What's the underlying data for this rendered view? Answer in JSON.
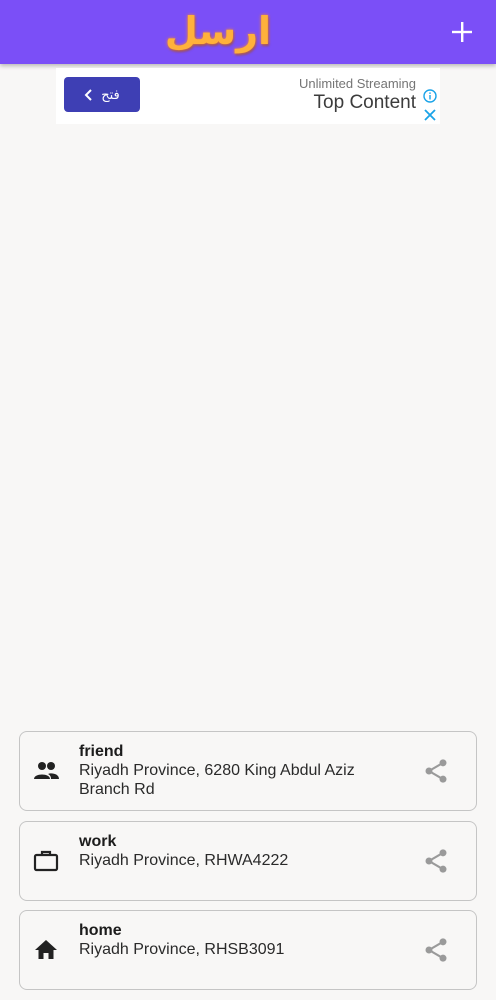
{
  "app_bar": {
    "logo_text": "ارسل",
    "add_icon": "plus-icon",
    "background_color": "#7b4ff7",
    "logo_color": "#ffb13b"
  },
  "ad": {
    "open_button_label": "فتح",
    "open_button_icon": "chevron-left-icon",
    "subtitle": "Unlimited Streaming",
    "title": "Top Content",
    "info_icon": "info-icon",
    "close_icon": "close-icon",
    "button_color": "#3e3fb4",
    "info_color": "#1aa3e8"
  },
  "addresses": [
    {
      "name": "friend",
      "address": "Riyadh Province, 6280 King Abdul Aziz Branch Rd",
      "icon": "people-icon",
      "share_icon": "share-icon"
    },
    {
      "name": "work",
      "address": "Riyadh Province, RHWA4222",
      "icon": "briefcase-icon",
      "share_icon": "share-icon"
    },
    {
      "name": "home",
      "address": "Riyadh Province, RHSB3091",
      "icon": "home-icon",
      "share_icon": "share-icon"
    }
  ]
}
